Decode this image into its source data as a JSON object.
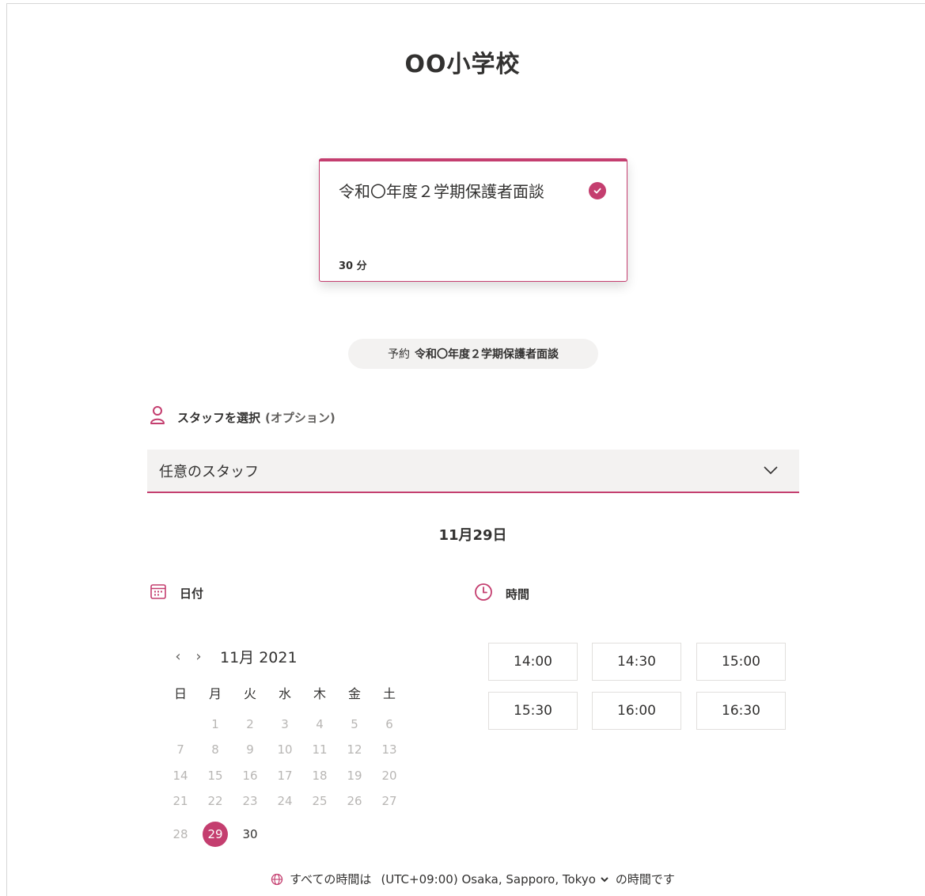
{
  "page": {
    "title": "OO小学校"
  },
  "service": {
    "name": "令和〇年度２学期保護者面談",
    "duration": "30 分",
    "accent_color": "#c43e6f"
  },
  "booking": {
    "prefix": "予約",
    "service": "令和〇年度２学期保護者面談"
  },
  "staff": {
    "label": "スタッフを選択",
    "optional": "(オプション)",
    "selected": "任意のスタッフ",
    "icon": "person-icon"
  },
  "selected_date": "11月29日",
  "date_section": {
    "label": "日付",
    "icon": "calendar-icon"
  },
  "time_section": {
    "label": "時間",
    "icon": "clock-icon"
  },
  "calendar": {
    "prev": "‹",
    "next": "›",
    "month": "11月 2021",
    "weekdays": [
      "日",
      "月",
      "火",
      "水",
      "木",
      "金",
      "土"
    ],
    "days": [
      "1",
      "2",
      "3",
      "4",
      "5",
      "6",
      "7",
      "8",
      "9",
      "10",
      "11",
      "12",
      "13",
      "14",
      "15",
      "16",
      "17",
      "18",
      "19",
      "20",
      "21",
      "22",
      "23",
      "24",
      "25",
      "26",
      "27",
      "28",
      "29",
      "30"
    ],
    "selected_day": "29",
    "available_days": [
      "29",
      "30"
    ]
  },
  "time_slots": [
    "14:00",
    "14:30",
    "15:00",
    "15:30",
    "16:00",
    "16:30"
  ],
  "timezone": {
    "prefix": "すべての時間は",
    "zone": "(UTC+09:00) Osaka, Sapporo, Tokyo",
    "suffix": "の時間です",
    "icon": "globe-icon"
  }
}
